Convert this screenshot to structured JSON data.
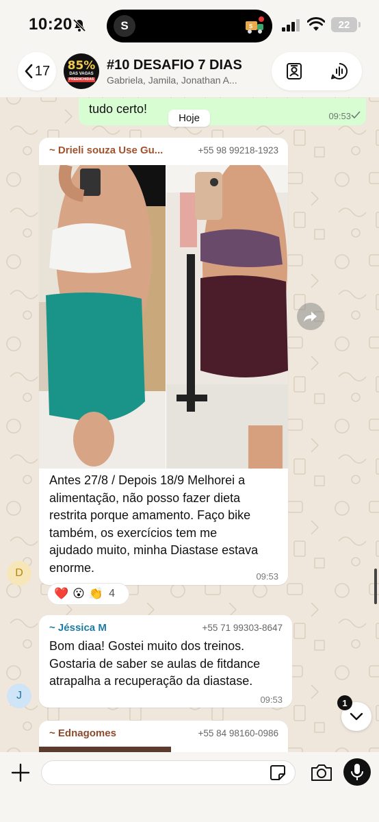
{
  "status_bar": {
    "time": "10:20",
    "island_avatar": "S",
    "battery": "22"
  },
  "header": {
    "back_count": "17",
    "avatar": {
      "big": "85%",
      "small": "DAS VAGAS",
      "tag": "PREENCHIDAS"
    },
    "title": "#10 DESAFIO 7 DIAS",
    "members": "Gabriela, Jamila, Jonathan A..."
  },
  "messages": {
    "outgoing": {
      "text": "tudo certo!",
      "time": "09:53"
    },
    "date_chip": "Hoje",
    "msg1": {
      "sender": "~ Drieli souza  Use Gu...",
      "phone": "+55 98 99218-1923",
      "text_lines": [
        "Antes 27/8 / Depois 18/9 Melhorei a",
        "alimentação, não posso fazer dieta",
        "restrita porque amamento. Faço bike",
        "também, os exercícios tem me",
        "ajudado muito, minha Diastase estava",
        "enorme."
      ],
      "time": "09:53",
      "avatar_letter": "D",
      "reactions": {
        "emoji1": "❤️",
        "emoji2": "😮",
        "emoji3": "👏",
        "count": "4"
      }
    },
    "msg2": {
      "sender": "~ Jéssica M",
      "phone": "+55 71 99303-8647",
      "text_lines": [
        "Bom diaa! Gostei muito dos treinos.",
        "Gostaria de saber se aulas de fitdance",
        "atrapalha a recuperação da diastase."
      ],
      "time": "09:53",
      "avatar_letter": "J"
    },
    "msg3": {
      "sender": "~ Ednagomes",
      "phone": "+55 84 98160-0986"
    }
  },
  "scroll_down": {
    "unread": "1"
  },
  "colors": {
    "wallpaper": "#efe7dc",
    "outgoing_bubble": "#d9fdd3",
    "sender1": "#a0522d",
    "sender2": "#1c7aa3",
    "sender3": "#8b4a2b",
    "avatar_d_bg": "#f7e6b8",
    "avatar_j_bg": "#cfe4f6"
  },
  "icons": [
    "bell-slash-icon",
    "signal-icon",
    "wifi-icon",
    "chevron-left-icon",
    "contact-card-icon",
    "audio-chat-icon",
    "forward-icon",
    "chevron-down-icon",
    "plus-icon",
    "sticker-icon",
    "camera-icon",
    "microphone-icon"
  ]
}
